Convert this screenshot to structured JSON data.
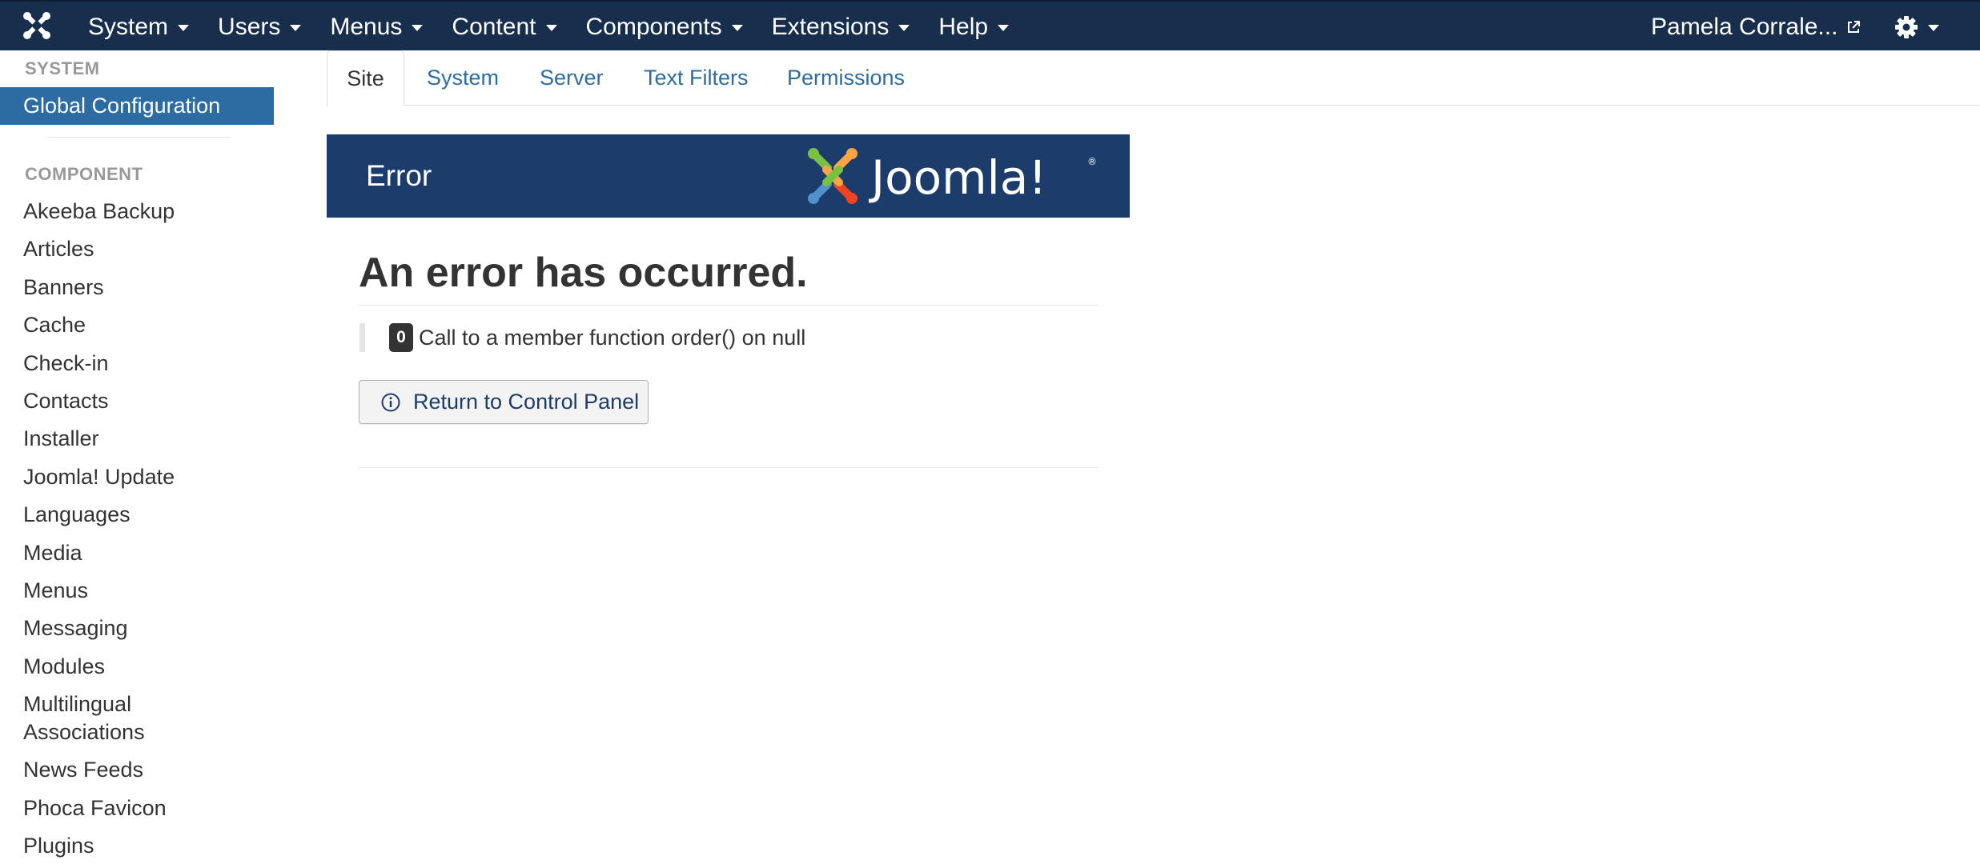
{
  "navbar": {
    "logo_icon": "joomla-icon",
    "menu": [
      {
        "label": "System"
      },
      {
        "label": "Users"
      },
      {
        "label": "Menus"
      },
      {
        "label": "Content"
      },
      {
        "label": "Components"
      },
      {
        "label": "Extensions"
      },
      {
        "label": "Help"
      }
    ],
    "user_label": "Pamela Corrale...",
    "user_icon": "external-link-icon",
    "settings_icon": "gear-icon",
    "background_color": "#172e4c"
  },
  "sidebar": {
    "system_heading": "SYSTEM",
    "active_item": "Global Configuration",
    "component_heading": "COMPONENT",
    "items": [
      {
        "label": "Akeeba Backup"
      },
      {
        "label": "Articles"
      },
      {
        "label": "Banners"
      },
      {
        "label": "Cache"
      },
      {
        "label": "Check-in"
      },
      {
        "label": "Contacts"
      },
      {
        "label": "Installer"
      },
      {
        "label": "Joomla! Update"
      },
      {
        "label": "Languages"
      },
      {
        "label": "Media"
      },
      {
        "label": "Menus"
      },
      {
        "label": "Messaging"
      },
      {
        "label": "Modules"
      },
      {
        "label": "Multilingual Associations"
      },
      {
        "label": "News Feeds"
      },
      {
        "label": "Phoca Favicon"
      },
      {
        "label": "Plugins"
      }
    ],
    "active_color": "#2d6ca2"
  },
  "tabs": [
    {
      "label": "Site",
      "active": true
    },
    {
      "label": "System"
    },
    {
      "label": "Server"
    },
    {
      "label": "Text Filters"
    },
    {
      "label": "Permissions"
    }
  ],
  "error": {
    "banner_title": "Error",
    "logo_text": "Joomla!",
    "heading": "An error has occurred.",
    "code": "0",
    "message": "Call to a member function order() on null",
    "button_label": "Return to Control Panel",
    "button_icon": "info-circle-icon",
    "banner_color": "#1c3d6b"
  }
}
